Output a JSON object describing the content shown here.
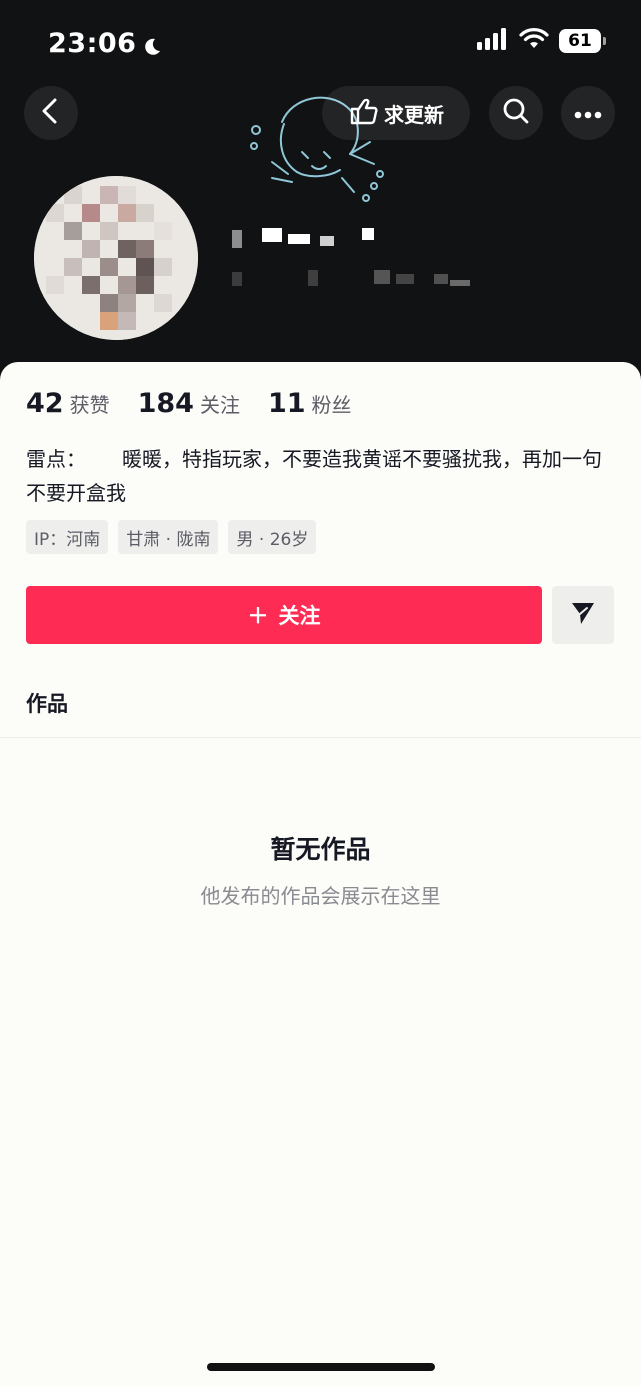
{
  "status_bar": {
    "time": "23:06",
    "battery": "61"
  },
  "header": {
    "request_update_label": "求更新"
  },
  "profile": {
    "stats": [
      {
        "value": "42",
        "label": "获赞"
      },
      {
        "value": "184",
        "label": "关注"
      },
      {
        "value": "11",
        "label": "粉丝"
      }
    ],
    "bio_prefix": "雷点：",
    "bio_rest": "暖暖，特指玩家，不要造我黄谣不要骚扰我，再加一句不要开盒我",
    "tags": [
      "IP：河南",
      "甘肃 · 陇南",
      "男 · 26岁"
    ]
  },
  "actions": {
    "follow_label": "关注",
    "follow_prefix": "＋"
  },
  "tabs": {
    "works_label": "作品"
  },
  "empty_state": {
    "title": "暂无作品",
    "subtitle": "他发布的作品会展示在这里"
  },
  "colors": {
    "accent": "#fe2c55",
    "header_bg": "#111213"
  },
  "icons": [
    "back-icon",
    "hand-point-icon",
    "search-icon",
    "more-icon",
    "send-icon",
    "moon-icon",
    "signal-icon",
    "wifi-icon"
  ]
}
